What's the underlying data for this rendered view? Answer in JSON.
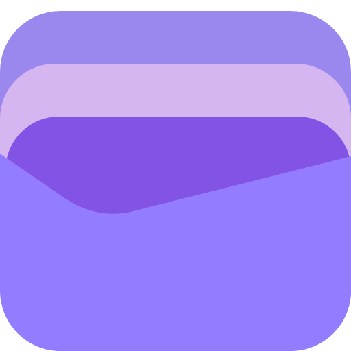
{
  "icon": {
    "name": "wallet-app-icon",
    "colors": {
      "background": "#ffffff",
      "back_card": "#9b88ef",
      "middle_card": "#d5b6f1",
      "front_card": "#8353e6",
      "pocket": "#937cff"
    }
  }
}
